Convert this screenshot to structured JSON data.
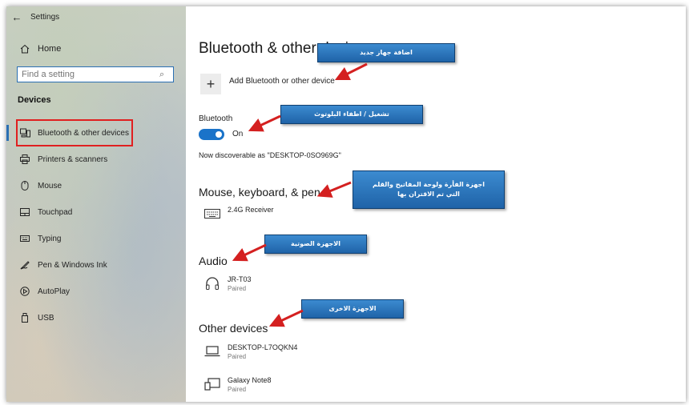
{
  "window": {
    "title": "Settings",
    "back_glyph": "←"
  },
  "sidebar": {
    "home_label": "Home",
    "search_placeholder": "Find a setting",
    "section_title": "Devices",
    "items": [
      {
        "label": "Bluetooth & other devices",
        "icon": "bluetooth-devices-icon",
        "selected": true
      },
      {
        "label": "Printers & scanners",
        "icon": "printer-icon"
      },
      {
        "label": "Mouse",
        "icon": "mouse-icon"
      },
      {
        "label": "Touchpad",
        "icon": "touchpad-icon"
      },
      {
        "label": "Typing",
        "icon": "keyboard-icon"
      },
      {
        "label": "Pen & Windows Ink",
        "icon": "pen-icon"
      },
      {
        "label": "AutoPlay",
        "icon": "autoplay-icon"
      },
      {
        "label": "USB",
        "icon": "usb-icon"
      }
    ]
  },
  "main": {
    "title": "Bluetooth & other devices",
    "add_device_label": "Add Bluetooth or other device",
    "bluetooth_label": "Bluetooth",
    "toggle_state": "On",
    "discoverable_text": "Now discoverable as \"DESKTOP-0SO969G\"",
    "groups": {
      "mkp": {
        "title": "Mouse, keyboard, & pen",
        "devices": [
          {
            "name": "2.4G Receiver",
            "status": "",
            "icon": "keyboard-icon"
          }
        ]
      },
      "audio": {
        "title": "Audio",
        "devices": [
          {
            "name": "JR-T03",
            "status": "Paired",
            "icon": "headphones-icon"
          }
        ]
      },
      "other": {
        "title": "Other devices",
        "devices": [
          {
            "name": "DESKTOP-L7OQKN4",
            "status": "Paired",
            "icon": "laptop-icon"
          },
          {
            "name": "Galaxy Note8",
            "status": "Paired",
            "icon": "phone-tablet-icon"
          }
        ]
      }
    }
  },
  "annotations": {
    "add_device": "اضافة جهاز جديد",
    "toggle": "تشغيل / اطفاء البلوتوث",
    "mkp_line1": "اجهزة الفأرة ولوحة المفاتيح والقلم",
    "mkp_line2": "التي تم الاقتران بها",
    "audio": "الاجهزة الصوتية",
    "other": "الاجهزة الاخرى"
  },
  "colors": {
    "accent": "#1a73c9",
    "highlight_border": "#e02020",
    "callout_bg": "#2a74bd",
    "arrow": "#d42020"
  }
}
